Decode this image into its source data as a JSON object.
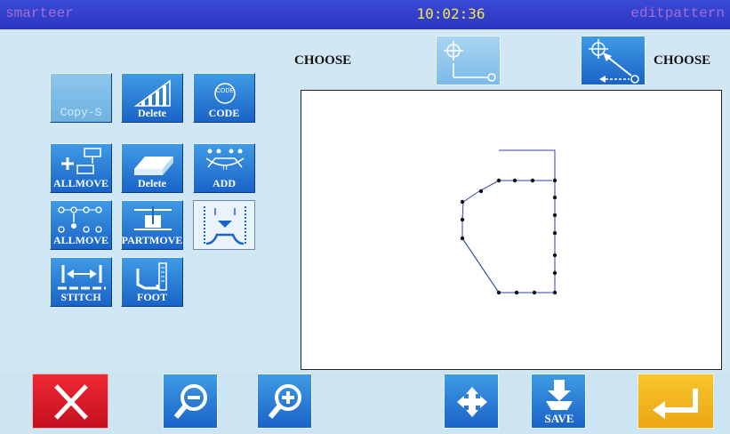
{
  "header": {
    "brand": "smarteer",
    "time": "10:02:36",
    "mode": "editpattern"
  },
  "choose_left": "CHOOSE",
  "choose_right": "CHOOSE",
  "buttons": {
    "copy_s": "Copy-S",
    "delete_top": "Delete",
    "code": "CODE",
    "code_badge": "CODE",
    "allmove_1": "ALLMOVE",
    "delete_2": "Delete",
    "add": "ADD",
    "allmove_2": "ALLMOVE",
    "partmove": "PARTMOVE",
    "stitch": "STITCH",
    "foot": "FOOT",
    "save": "SAVE"
  },
  "colors": {
    "accent": "#1a63c8",
    "cancel": "#d8182a",
    "enter": "#f2b51e",
    "clock": "#f4e64a"
  }
}
